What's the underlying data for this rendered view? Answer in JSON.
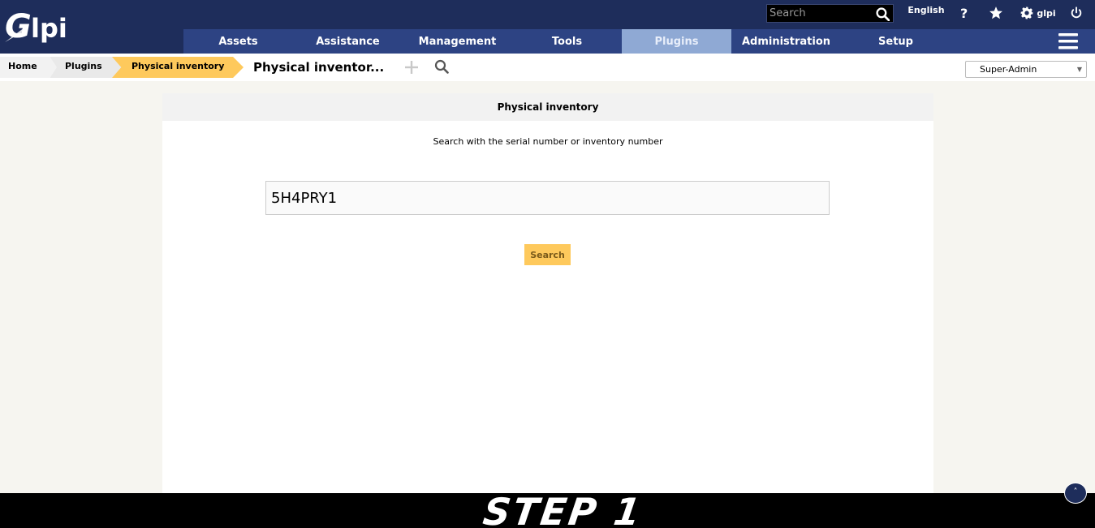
{
  "header": {
    "logo_text": "Glpi",
    "search_placeholder": "Search",
    "language": "English",
    "username": "glpi"
  },
  "main_menu": [
    {
      "label": "Assets",
      "active": false
    },
    {
      "label": "Assistance",
      "active": false
    },
    {
      "label": "Management",
      "active": false
    },
    {
      "label": "Tools",
      "active": false
    },
    {
      "label": "Plugins",
      "active": true
    },
    {
      "label": "Administration",
      "active": false
    },
    {
      "label": "Setup",
      "active": false
    }
  ],
  "breadcrumb": {
    "home": "Home",
    "plugins": "Plugins",
    "current": "Physical inventory",
    "page_title": "Physical inventor..."
  },
  "profile": {
    "selected": "Super-Admin"
  },
  "panel": {
    "title": "Physical inventory",
    "instruction": "Search with the serial number or inventory number",
    "serial_value": "5H4PRY1",
    "search_button": "Search"
  },
  "overlay": {
    "step_text": "STEP 1"
  },
  "colors": {
    "topbar": "#1e2d5b",
    "menubar": "#2d4383",
    "menu_active": "#8fa9d4",
    "accent": "#fec95c",
    "page_bg": "#f6f5f0"
  },
  "icons": {
    "top_search": "search-icon",
    "help": "help-icon",
    "favorites": "star-icon",
    "preferences": "gear-icon",
    "logout": "power-icon",
    "menu": "hamburger-icon",
    "add": "plus-icon",
    "crumb_search": "search-icon",
    "back_to_top": "chevron-up-icon"
  }
}
